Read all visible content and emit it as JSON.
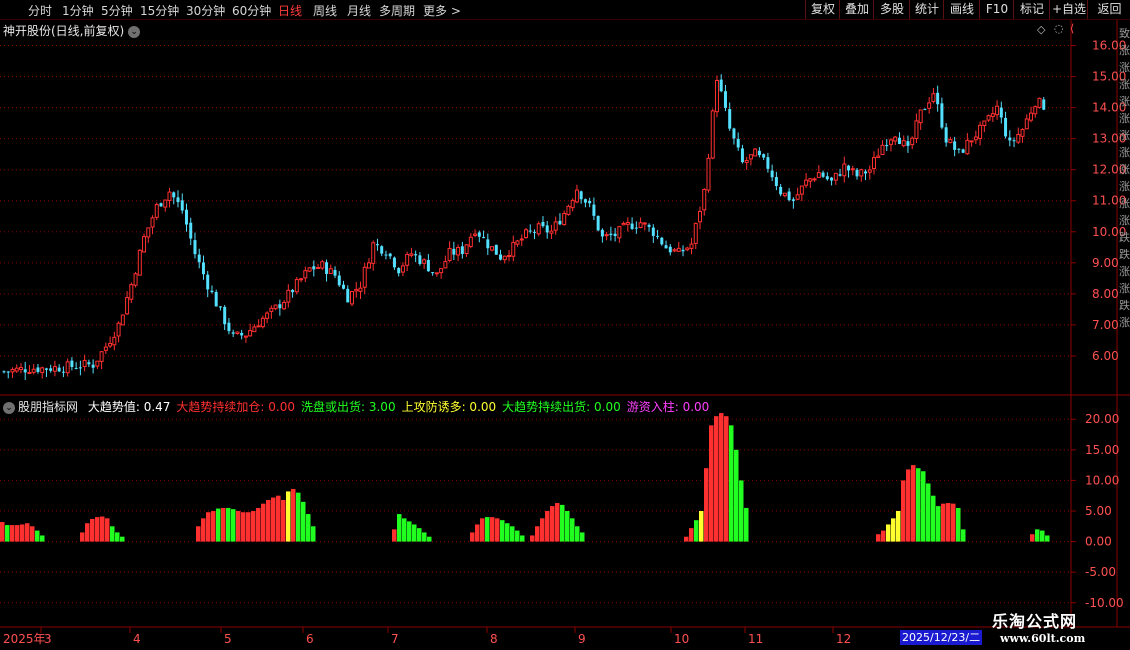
{
  "toolbar": {
    "periods": [
      "分时",
      "1分钟",
      "5分钟",
      "15分钟",
      "30分钟",
      "60分钟",
      "日线",
      "周线",
      "月线",
      "多周期",
      "更多 >"
    ],
    "active_period": "日线",
    "buttons": [
      "复权",
      "叠加",
      "多股",
      "统计",
      "画线",
      "F10",
      "标记",
      "+自选",
      "返回"
    ]
  },
  "main_chart": {
    "title": "神开股份(日线,前复权)",
    "price_ticks": [
      "16.00",
      "15.00",
      "14.00",
      "13.00",
      "12.00",
      "11.00",
      "10.00",
      "9.00",
      "8.00",
      "7.00",
      "6.00"
    ],
    "side_text": "致涨涨涨涨涨涨涨涨涨涨涨跌跌涨涨跌涨"
  },
  "indicator": {
    "name": "股朋指标网",
    "values": [
      {
        "label": "大趋势值:",
        "value": "0.47",
        "color": "#ffffff"
      },
      {
        "label": "大趋势持续加仓:",
        "value": "0.00",
        "color": "#ff3030"
      },
      {
        "label": "洗盘或出货:",
        "value": "3.00",
        "color": "#20ff20"
      },
      {
        "label": "上攻防诱多:",
        "value": "0.00",
        "color": "#ffff30"
      },
      {
        "label": "大趋势持续出货:",
        "value": "0.00",
        "color": "#20ff20"
      },
      {
        "label": "游资入柱:",
        "value": "0.00",
        "color": "#ff40ff"
      }
    ],
    "ticks": [
      "20.00",
      "15.00",
      "10.00",
      "5.00",
      "0.00",
      "-5.00",
      "-10.00"
    ]
  },
  "x_axis": {
    "year_label": "2025年",
    "months": [
      "3",
      "4",
      "5",
      "6",
      "7",
      "8",
      "9",
      "10",
      "11",
      "12"
    ],
    "date_info": "2025/12/23/二"
  },
  "watermark": {
    "line1": "乐淘公式网",
    "line2": "www.60lt.com"
  },
  "colors": {
    "up": "#ff3030",
    "down": "#54e0ff",
    "green": "#20ff20",
    "yellow": "#ffff30",
    "grid": "#8b0000",
    "axis_text": "#ff5050"
  },
  "chart_data": {
    "type": "candlestick",
    "price_ylim": [
      5.0,
      16.5
    ],
    "close_series": [
      5.5,
      5.55,
      5.6,
      5.6,
      5.62,
      5.65,
      5.7,
      5.72,
      6.3,
      7.0,
      8.3,
      9.8,
      10.8,
      11.3,
      10.7,
      9.3,
      8.3,
      7.4,
      6.6,
      6.7,
      7.1,
      7.4,
      7.8,
      8.3,
      8.8,
      8.9,
      8.6,
      7.9,
      8.3,
      9.6,
      9.4,
      8.8,
      9.3,
      9.0,
      8.6,
      9.3,
      9.4,
      10.1,
      9.6,
      9.2,
      9.5,
      9.9,
      10.1,
      10.0,
      10.6,
      11.4,
      10.8,
      9.8,
      9.9,
      10.2,
      10.3,
      10.0,
      9.5,
      9.3,
      9.6,
      11.3,
      15.0,
      13.3,
      12.2,
      12.5,
      12.1,
      11.3,
      11.0,
      11.6,
      11.9,
      11.6,
      12.1,
      11.8,
      12.0,
      12.8,
      13.2,
      12.6,
      13.8,
      14.5,
      13.0,
      12.5,
      13.0,
      13.4,
      14.0,
      12.8,
      13.3,
      14.2,
      14.0
    ]
  },
  "indicator_data": {
    "type": "bar",
    "ylim": [
      -12,
      22
    ],
    "segments": [
      {
        "start": 0,
        "values": [
          3.2,
          2.7,
          2.7,
          2.7,
          2.8,
          3.0,
          2.5,
          1.8,
          1.0
        ],
        "colors": [
          "r",
          "g",
          "r",
          "r",
          "r",
          "r",
          "r",
          "g",
          "g"
        ]
      },
      {
        "start": 80,
        "values": [
          1.5,
          3.0,
          3.7,
          4.0,
          4.1,
          3.8,
          2.5,
          1.5,
          0.8
        ],
        "colors": [
          "r",
          "r",
          "r",
          "r",
          "r",
          "r",
          "g",
          "g",
          "g"
        ]
      },
      {
        "start": 196,
        "values": [
          2.5,
          3.8,
          4.8,
          5.0,
          5.4,
          5.5,
          5.5,
          5.3,
          5.0,
          4.8,
          4.8,
          5.0,
          5.5,
          6.2,
          6.8,
          7.2,
          7.5,
          6.8,
          8.2,
          8.6,
          8.0,
          6.5,
          4.5,
          2.5
        ],
        "colors": [
          "r",
          "r",
          "r",
          "r",
          "g",
          "r",
          "g",
          "g",
          "r",
          "r",
          "r",
          "r",
          "r",
          "r",
          "r",
          "r",
          "r",
          "r",
          "y",
          "r",
          "g",
          "g",
          "g",
          "g"
        ]
      },
      {
        "start": 392,
        "values": [
          2.0,
          4.5,
          3.8,
          3.3,
          2.8,
          2.2,
          1.5,
          0.8
        ],
        "colors": [
          "r",
          "g",
          "g",
          "g",
          "g",
          "g",
          "g",
          "g"
        ]
      },
      {
        "start": 470,
        "values": [
          1.5,
          2.8,
          3.8,
          4.0,
          4.0,
          3.8,
          3.5,
          3.0,
          2.5,
          1.8,
          1.0
        ],
        "colors": [
          "r",
          "r",
          "r",
          "g",
          "r",
          "r",
          "g",
          "g",
          "g",
          "g",
          "g"
        ]
      },
      {
        "start": 530,
        "values": [
          1.0,
          2.5,
          3.8,
          5.0,
          5.8,
          6.3,
          6.0,
          5.0,
          3.8,
          2.5,
          1.5
        ],
        "colors": [
          "r",
          "r",
          "r",
          "r",
          "r",
          "r",
          "g",
          "g",
          "g",
          "g",
          "g"
        ]
      },
      {
        "start": 684,
        "values": [
          0.8,
          2.2,
          3.5,
          5.0,
          12.0,
          19.0,
          20.5,
          21.0,
          20.5,
          19.0,
          15.0,
          10.0,
          5.5
        ],
        "colors": [
          "r",
          "r",
          "g",
          "y",
          "r",
          "r",
          "r",
          "r",
          "r",
          "g",
          "g",
          "g",
          "g"
        ]
      },
      {
        "start": 876,
        "values": [
          1.2,
          1.8,
          2.8,
          3.8,
          5.0,
          10.0,
          11.8,
          12.5,
          12.0,
          11.5,
          9.5,
          7.5,
          5.8,
          6.2,
          6.3,
          6.2,
          5.5,
          2.0
        ],
        "colors": [
          "r",
          "r",
          "y",
          "y",
          "y",
          "r",
          "r",
          "r",
          "g",
          "g",
          "g",
          "g",
          "g",
          "r",
          "r",
          "r",
          "g",
          "g"
        ]
      },
      {
        "start": 1030,
        "values": [
          1.2,
          2.0,
          1.8,
          1.0
        ],
        "colors": [
          "r",
          "g",
          "g",
          "g"
        ]
      }
    ]
  }
}
